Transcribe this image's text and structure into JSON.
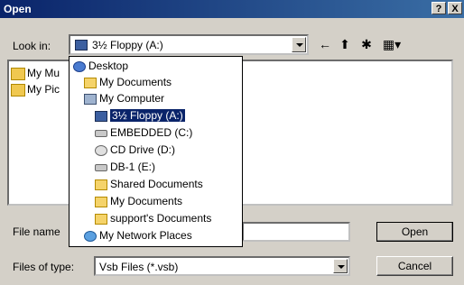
{
  "window": {
    "title": "Open",
    "help_button": "?",
    "close_button": "X"
  },
  "look_in": {
    "label": "Look in:",
    "selected": "3½ Floppy (A:)"
  },
  "toolbar": {
    "icons": [
      "back-icon",
      "up-folder-icon",
      "new-folder-icon",
      "view-menu-icon"
    ]
  },
  "files": [
    {
      "name": "My Mu",
      "icon": "folder-icon"
    },
    {
      "name": "My Pic",
      "icon": "folder-icon"
    }
  ],
  "dropdown": {
    "items": [
      {
        "label": "Desktop",
        "icon": "desktop-icon",
        "indent": 0,
        "selected": false
      },
      {
        "label": "My Documents",
        "icon": "folder-icon",
        "indent": 1,
        "selected": false
      },
      {
        "label": "My Computer",
        "icon": "computer-icon",
        "indent": 1,
        "selected": false
      },
      {
        "label": "3½ Floppy (A:)",
        "icon": "floppy-icon",
        "indent": 2,
        "selected": true
      },
      {
        "label": "EMBEDDED (C:)",
        "icon": "drive-icon",
        "indent": 2,
        "selected": false
      },
      {
        "label": "CD Drive (D:)",
        "icon": "cd-icon",
        "indent": 2,
        "selected": false
      },
      {
        "label": "DB-1 (E:)",
        "icon": "drive-icon",
        "indent": 2,
        "selected": false
      },
      {
        "label": "Shared Documents",
        "icon": "folder-icon",
        "indent": 2,
        "selected": false
      },
      {
        "label": "My Documents",
        "icon": "folder-icon",
        "indent": 2,
        "selected": false
      },
      {
        "label": "support's Documents",
        "icon": "folder-icon",
        "indent": 2,
        "selected": false
      },
      {
        "label": "My Network Places",
        "icon": "network-icon",
        "indent": 1,
        "selected": false
      }
    ]
  },
  "file_name": {
    "label": "File name",
    "value": ""
  },
  "files_of_type": {
    "label": "Files of type:",
    "selected": "Vsb Files (*.vsb)"
  },
  "buttons": {
    "open": "Open",
    "cancel": "Cancel"
  }
}
